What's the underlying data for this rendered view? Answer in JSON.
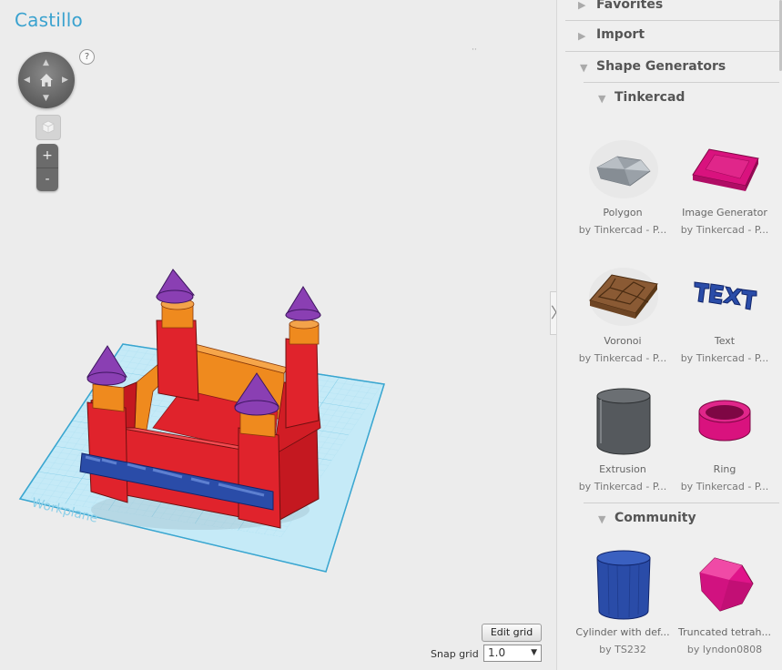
{
  "design": {
    "title": "Castillo"
  },
  "viewport": {
    "help_label": "?",
    "dots": "··",
    "workplane_label": "Workplane",
    "zoom_in": "+",
    "zoom_out": "-",
    "edit_grid": "Edit grid",
    "snap_grid_label": "Snap grid",
    "snap_grid_value": "1.0"
  },
  "sidebar": {
    "collapse_glyph": "〉",
    "favorites": "Favorites",
    "import": "Import",
    "shape_generators": "Shape Generators",
    "tinkercad": "Tinkercad",
    "community": "Community",
    "tinkercad_shapes": [
      {
        "name": "Polygon",
        "author": "by Tinkercad - P..."
      },
      {
        "name": "Image Generator",
        "author": "by Tinkercad - P..."
      },
      {
        "name": "Voronoi",
        "author": "by Tinkercad - P..."
      },
      {
        "name": "Text",
        "author": "by Tinkercad - P..."
      },
      {
        "name": "Extrusion",
        "author": "by Tinkercad - P..."
      },
      {
        "name": "Ring",
        "author": "by Tinkercad - P..."
      }
    ],
    "community_shapes": [
      {
        "name": "Cylinder with def...",
        "author": "by TS232"
      },
      {
        "name": "Truncated tetrah...",
        "author": "by lyndon0808"
      }
    ]
  },
  "colors": {
    "accent": "#3aa2cf",
    "castle_red": "#e0232c",
    "castle_orange": "#ef8a1e",
    "tower_purple": "#8a3fb3",
    "text_blue": "#2a4ca8",
    "workplane": "#bfe7f5"
  }
}
